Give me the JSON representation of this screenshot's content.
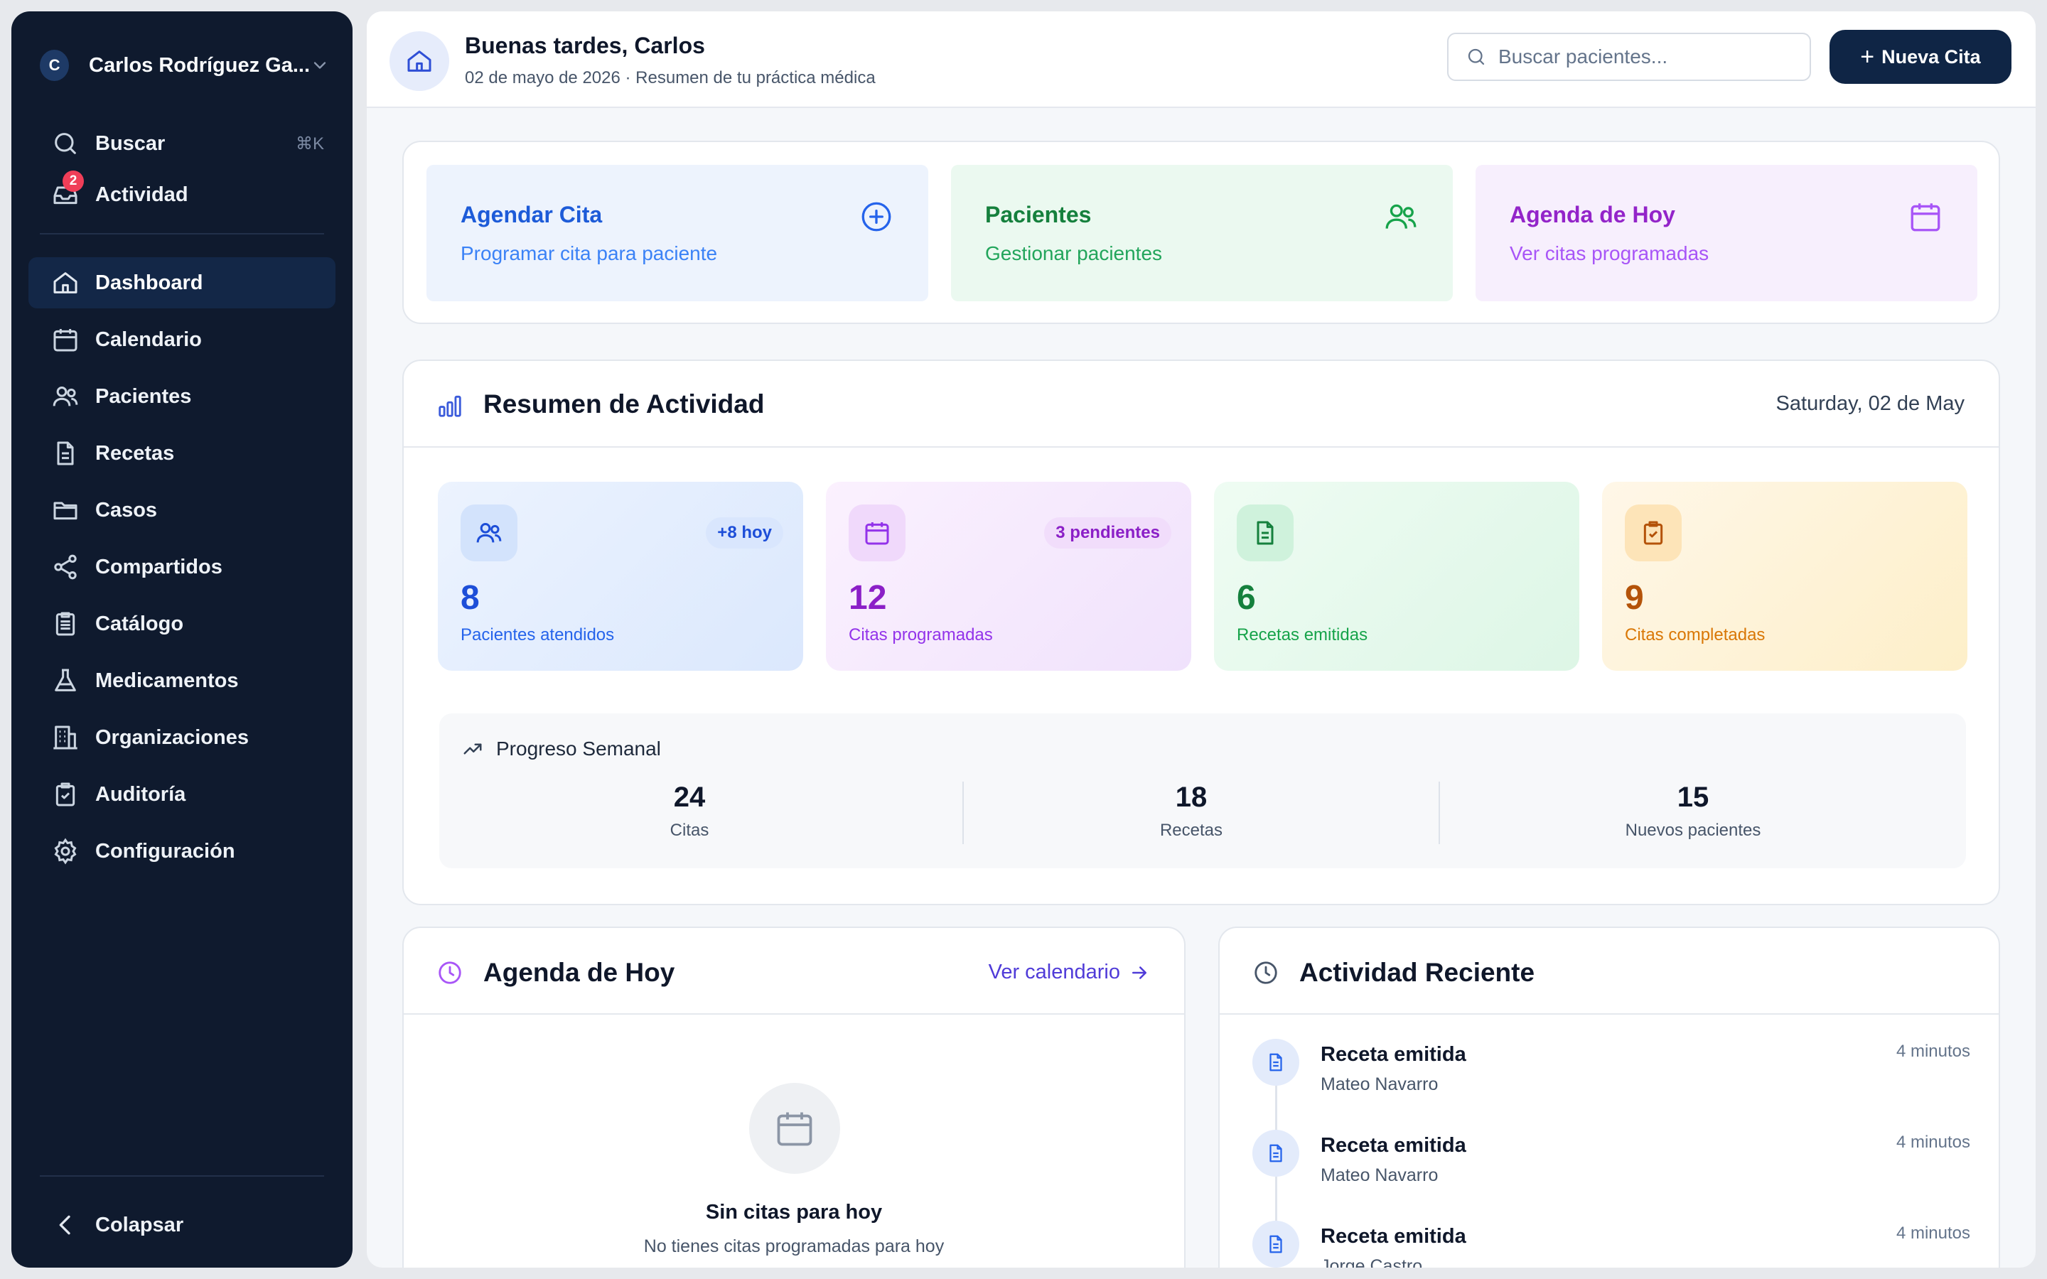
{
  "sidebar": {
    "user": {
      "initial": "C",
      "name": "Carlos Rodríguez Ga..."
    },
    "search": {
      "label": "Buscar",
      "shortcut": "⌘K"
    },
    "activity": {
      "label": "Actividad",
      "badge": "2"
    },
    "nav": [
      {
        "label": "Dashboard",
        "icon": "home-icon",
        "active": true
      },
      {
        "label": "Calendario",
        "icon": "calendar-icon"
      },
      {
        "label": "Pacientes",
        "icon": "users-icon"
      },
      {
        "label": "Recetas",
        "icon": "document-icon"
      },
      {
        "label": "Casos",
        "icon": "folder-icon"
      },
      {
        "label": "Compartidos",
        "icon": "share-icon"
      },
      {
        "label": "Catálogo",
        "icon": "catalog-icon"
      },
      {
        "label": "Medicamentos",
        "icon": "flask-icon"
      },
      {
        "label": "Organizaciones",
        "icon": "building-icon"
      },
      {
        "label": "Auditoría",
        "icon": "clipboard-check-icon"
      },
      {
        "label": "Configuración",
        "icon": "gear-icon"
      }
    ],
    "collapse_label": "Colapsar"
  },
  "header": {
    "greeting": "Buenas tardes, Carlos",
    "subtitle": "02 de mayo de 2026 · Resumen de tu práctica médica",
    "search_placeholder": "Buscar pacientes...",
    "new_button": "Nueva Cita",
    "new_button_icon": "+"
  },
  "quick_actions": [
    {
      "title": "Agendar Cita",
      "subtitle": "Programar cita para paciente",
      "icon": "plus-circle-icon",
      "color": "#1d5bd8",
      "bg": "#edf3fd"
    },
    {
      "title": "Pacientes",
      "subtitle": "Gestionar pacientes",
      "icon": "users-icon",
      "color": "#15803d",
      "bg": "#ebf9f0"
    },
    {
      "title": "Agenda de Hoy",
      "subtitle": "Ver citas programadas",
      "icon": "calendar-icon",
      "color": "#9324c9",
      "bg": "#f7effd"
    }
  ],
  "summary": {
    "title": "Resumen de Actividad",
    "date": "Saturday, 02 de May",
    "stats": [
      {
        "value": "8",
        "label": "Pacientes atendidos",
        "badge": "+8 hoy",
        "icon": "users-icon",
        "color": "#1d4ed8"
      },
      {
        "value": "12",
        "label": "Citas programadas",
        "badge": "3 pendientes",
        "icon": "calendar-icon",
        "color": "#8b1fc7"
      },
      {
        "value": "6",
        "label": "Recetas emitidas",
        "badge": "",
        "icon": "document-icon",
        "color": "#15803d"
      },
      {
        "value": "9",
        "label": "Citas completadas",
        "badge": "",
        "icon": "clipboard-check-icon",
        "color": "#b45309"
      }
    ],
    "weekly": {
      "title": "Progreso Semanal",
      "items": [
        {
          "value": "24",
          "label": "Citas"
        },
        {
          "value": "18",
          "label": "Recetas"
        },
        {
          "value": "15",
          "label": "Nuevos pacientes"
        }
      ]
    }
  },
  "agenda": {
    "title": "Agenda de Hoy",
    "link": "Ver calendario",
    "empty_title": "Sin citas para hoy",
    "empty_subtitle": "No tienes citas programadas para hoy"
  },
  "recent": {
    "title": "Actividad Reciente",
    "items": [
      {
        "title": "Receta emitida",
        "subtitle": "Mateo Navarro",
        "time": "4 minutos"
      },
      {
        "title": "Receta emitida",
        "subtitle": "Mateo Navarro",
        "time": "4 minutos"
      },
      {
        "title": "Receta emitida",
        "subtitle": "Jorge Castro",
        "time": "4 minutos"
      }
    ]
  }
}
